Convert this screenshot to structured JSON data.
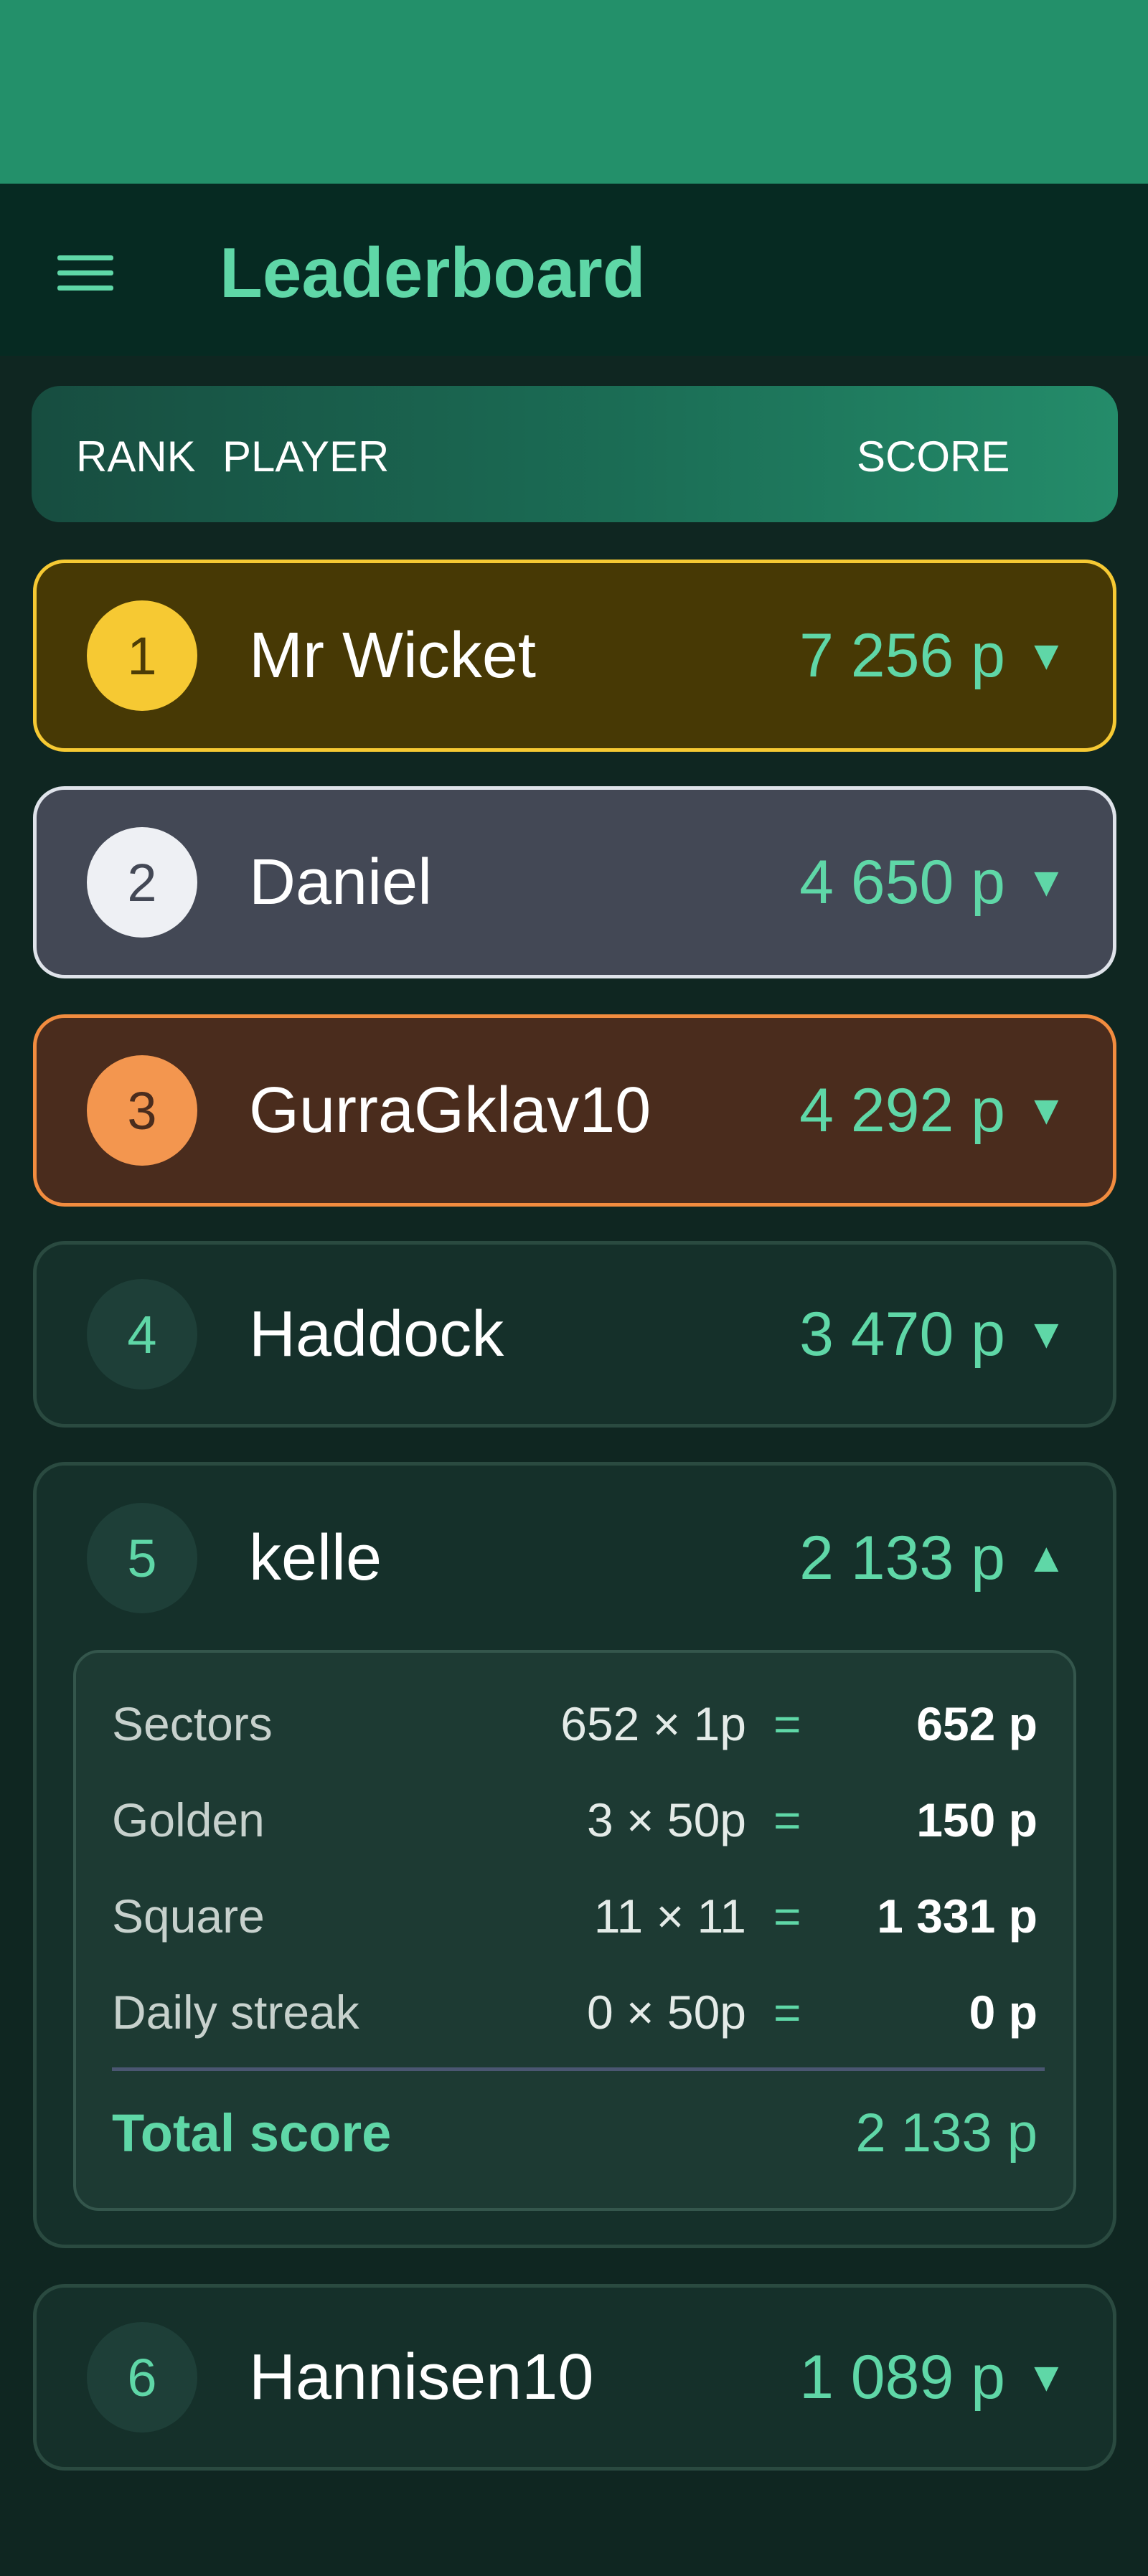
{
  "app": {
    "title": "Leaderboard"
  },
  "header": {
    "rank": "RANK",
    "player": "PLAYER",
    "score": "SCORE"
  },
  "players": [
    {
      "rank": "1",
      "name": "Mr Wicket",
      "score": "7 256 p",
      "chevron": "▼",
      "tier": "gold"
    },
    {
      "rank": "2",
      "name": "Daniel",
      "score": "4 650 p",
      "chevron": "▼",
      "tier": "silver"
    },
    {
      "rank": "3",
      "name": "GurraGklav10",
      "score": "4 292 p",
      "chevron": "▼",
      "tier": "bronze"
    },
    {
      "rank": "4",
      "name": "Haddock",
      "score": "3 470 p",
      "chevron": "▼",
      "tier": "default"
    },
    {
      "rank": "5",
      "name": "kelle",
      "score": "2 133 p",
      "chevron": "▲",
      "tier": "default"
    },
    {
      "rank": "6",
      "name": "Hannisen10",
      "score": "1 089 p",
      "chevron": "▼",
      "tier": "default"
    }
  ],
  "breakdown": {
    "rows": [
      {
        "label": "Sectors",
        "calc": "652 × 1p",
        "eq": "=",
        "value": "652 p"
      },
      {
        "label": "Golden",
        "calc": "3 × 50p",
        "eq": "=",
        "value": "150 p"
      },
      {
        "label": "Square",
        "calc": "11 × 11",
        "eq": "=",
        "value": "1 331 p"
      },
      {
        "label": "Daily streak",
        "calc": "0 × 50p",
        "eq": "=",
        "value": "0 p"
      }
    ],
    "total_label": "Total score",
    "total_value": "2 133 p"
  },
  "colors": {
    "accent": "#5fd7a7",
    "gold": "#f6c933",
    "silver": "#dfe3ea",
    "bronze": "#f28c3f",
    "background": "#0f2621"
  }
}
